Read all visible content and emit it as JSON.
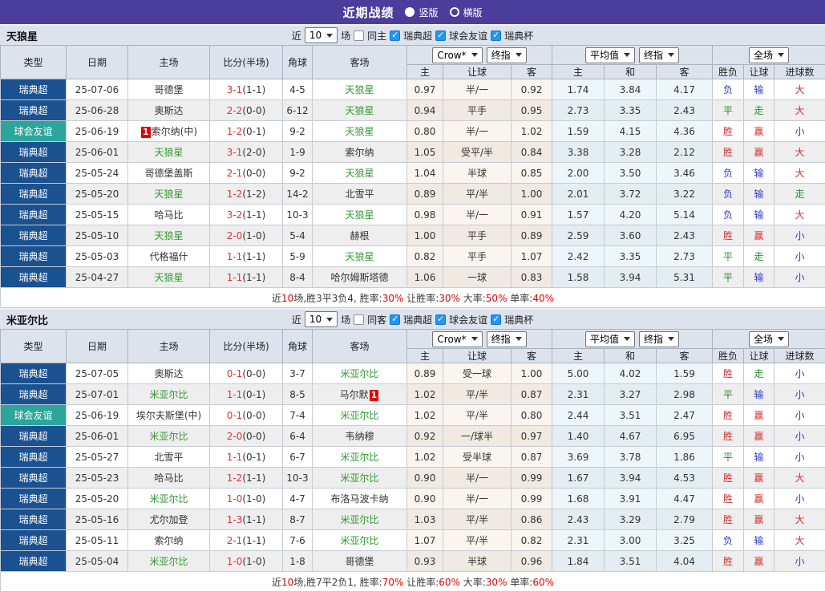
{
  "colors": {
    "titlebar_purple": "#4a3d9c",
    "league_type_navy": "#1a5190",
    "friendly_type_teal": "#2aa69a",
    "highlight_team_green": "#339933",
    "score_red": "#e03333",
    "win_red": "#d03030",
    "lose_blue": "#2e3bc0",
    "draw_green": "#2e8b2e",
    "badge_red": "#e60000"
  },
  "header": {
    "title": "近期战绩",
    "radio_vertical": "竖版",
    "radio_horizontal": "横版",
    "selected": "竖版"
  },
  "table": {
    "columns": [
      "类型",
      "日期",
      "主场",
      "比分(半场)",
      "角球",
      "客场",
      "主",
      "让球",
      "客",
      "主",
      "和",
      "客",
      "胜负",
      "让球",
      "进球数"
    ],
    "selects": {
      "bookmaker": "Crow*",
      "index1": "终指",
      "avg": "平均值",
      "index2": "终指",
      "scope": "全场"
    }
  },
  "sections": [
    {
      "team": "天狼星",
      "filter": {
        "near": "近",
        "count": "10",
        "games": "场",
        "same": "同主",
        "same_checked": false,
        "leagues": [
          {
            "label": "瑞典超",
            "checked": true
          },
          {
            "label": "球会友谊",
            "checked": true
          },
          {
            "label": "瑞典杯",
            "checked": true
          }
        ]
      },
      "rows": [
        {
          "type": "瑞典超",
          "type_style": "navy",
          "date": "25-07-06",
          "home": {
            "text": "哥德堡"
          },
          "score": "3-1",
          "half": "(1-1)",
          "corner": "4-5",
          "away": {
            "text": "天狼星",
            "hl": true
          },
          "odds": [
            "0.97",
            "半/一",
            "0.92"
          ],
          "avg": [
            "1.74",
            "3.84",
            "4.17"
          ],
          "res": [
            [
              "负",
              "blue"
            ],
            [
              "输",
              "blue"
            ],
            [
              "大",
              "red"
            ]
          ]
        },
        {
          "type": "瑞典超",
          "type_style": "navy",
          "date": "25-06-28",
          "home": {
            "text": "奥斯达"
          },
          "score": "2-2",
          "half": "(0-0)",
          "corner": "6-12",
          "away": {
            "text": "天狼星",
            "hl": true
          },
          "odds": [
            "0.94",
            "平手",
            "0.95"
          ],
          "avg": [
            "2.73",
            "3.35",
            "2.43"
          ],
          "res": [
            [
              "平",
              "green"
            ],
            [
              "走",
              "green"
            ],
            [
              "大",
              "red"
            ]
          ]
        },
        {
          "type": "球会友谊",
          "type_style": "teal",
          "date": "25-06-19",
          "home": {
            "text": "索尔纳(中)",
            "badge_pre": "1"
          },
          "score": "1-2",
          "half": "(0-1)",
          "corner": "9-2",
          "away": {
            "text": "天狼星",
            "hl": true
          },
          "odds": [
            "0.80",
            "半/一",
            "1.02"
          ],
          "avg": [
            "1.59",
            "4.15",
            "4.36"
          ],
          "res": [
            [
              "胜",
              "red"
            ],
            [
              "赢",
              "red"
            ],
            [
              "小",
              "blue"
            ]
          ]
        },
        {
          "type": "瑞典超",
          "type_style": "navy",
          "date": "25-06-01",
          "home": {
            "text": "天狼星",
            "hl": true
          },
          "score": "3-1",
          "half": "(2-0)",
          "corner": "1-9",
          "away": {
            "text": "索尔纳"
          },
          "odds": [
            "1.05",
            "受平/半",
            "0.84"
          ],
          "avg": [
            "3.38",
            "3.28",
            "2.12"
          ],
          "res": [
            [
              "胜",
              "red"
            ],
            [
              "赢",
              "red"
            ],
            [
              "大",
              "red"
            ]
          ]
        },
        {
          "type": "瑞典超",
          "type_style": "navy",
          "date": "25-05-24",
          "home": {
            "text": "哥德堡盖斯"
          },
          "score": "2-1",
          "half": "(0-0)",
          "corner": "9-2",
          "away": {
            "text": "天狼星",
            "hl": true
          },
          "odds": [
            "1.04",
            "半球",
            "0.85"
          ],
          "avg": [
            "2.00",
            "3.50",
            "3.46"
          ],
          "res": [
            [
              "负",
              "blue"
            ],
            [
              "输",
              "blue"
            ],
            [
              "大",
              "red"
            ]
          ]
        },
        {
          "type": "瑞典超",
          "type_style": "navy",
          "date": "25-05-20",
          "home": {
            "text": "天狼星",
            "hl": true
          },
          "score": "1-2",
          "half": "(1-2)",
          "corner": "14-2",
          "away": {
            "text": "北雪平"
          },
          "odds": [
            "0.89",
            "平/半",
            "1.00"
          ],
          "avg": [
            "2.01",
            "3.72",
            "3.22"
          ],
          "res": [
            [
              "负",
              "blue"
            ],
            [
              "输",
              "blue"
            ],
            [
              "走",
              "green"
            ]
          ]
        },
        {
          "type": "瑞典超",
          "type_style": "navy",
          "date": "25-05-15",
          "home": {
            "text": "哈马比"
          },
          "score": "3-2",
          "half": "(1-1)",
          "corner": "10-3",
          "away": {
            "text": "天狼星",
            "hl": true
          },
          "odds": [
            "0.98",
            "半/一",
            "0.91"
          ],
          "avg": [
            "1.57",
            "4.20",
            "5.14"
          ],
          "res": [
            [
              "负",
              "blue"
            ],
            [
              "输",
              "blue"
            ],
            [
              "大",
              "red"
            ]
          ]
        },
        {
          "type": "瑞典超",
          "type_style": "navy",
          "date": "25-05-10",
          "home": {
            "text": "天狼星",
            "hl": true
          },
          "score": "2-0",
          "half": "(1-0)",
          "corner": "5-4",
          "away": {
            "text": "赫根"
          },
          "odds": [
            "1.00",
            "平手",
            "0.89"
          ],
          "avg": [
            "2.59",
            "3.60",
            "2.43"
          ],
          "res": [
            [
              "胜",
              "red"
            ],
            [
              "赢",
              "red"
            ],
            [
              "小",
              "blue"
            ]
          ]
        },
        {
          "type": "瑞典超",
          "type_style": "navy",
          "date": "25-05-03",
          "home": {
            "text": "代格福什"
          },
          "score": "1-1",
          "half": "(1-1)",
          "corner": "5-9",
          "away": {
            "text": "天狼星",
            "hl": true
          },
          "odds": [
            "0.82",
            "平手",
            "1.07"
          ],
          "avg": [
            "2.42",
            "3.35",
            "2.73"
          ],
          "res": [
            [
              "平",
              "green"
            ],
            [
              "走",
              "green"
            ],
            [
              "小",
              "blue"
            ]
          ]
        },
        {
          "type": "瑞典超",
          "type_style": "navy",
          "date": "25-04-27",
          "home": {
            "text": "天狼星",
            "hl": true
          },
          "score": "1-1",
          "half": "(1-1)",
          "corner": "8-4",
          "away": {
            "text": "哈尔姆斯塔德"
          },
          "odds": [
            "1.06",
            "一球",
            "0.83"
          ],
          "avg": [
            "1.58",
            "3.94",
            "5.31"
          ],
          "res": [
            [
              "平",
              "green"
            ],
            [
              "输",
              "blue"
            ],
            [
              "小",
              "blue"
            ]
          ]
        }
      ],
      "summary": [
        [
          "近",
          "dark"
        ],
        [
          "10",
          "red"
        ],
        [
          "场,胜3平3负4, 胜率:",
          "dark"
        ],
        [
          "30%",
          "red"
        ],
        [
          " 让胜率:",
          "dark"
        ],
        [
          "30%",
          "red"
        ],
        [
          " 大率:",
          "dark"
        ],
        [
          "50%",
          "red"
        ],
        [
          " 单率:",
          "dark"
        ],
        [
          "40%",
          "red"
        ]
      ]
    },
    {
      "team": "米亚尔比",
      "filter": {
        "near": "近",
        "count": "10",
        "games": "场",
        "same": "同客",
        "same_checked": false,
        "leagues": [
          {
            "label": "瑞典超",
            "checked": true
          },
          {
            "label": "球会友谊",
            "checked": true
          },
          {
            "label": "瑞典杯",
            "checked": true
          }
        ]
      },
      "rows": [
        {
          "type": "瑞典超",
          "type_style": "navy",
          "date": "25-07-05",
          "home": {
            "text": "奥斯达"
          },
          "score": "0-1",
          "half": "(0-0)",
          "corner": "3-7",
          "away": {
            "text": "米亚尔比",
            "hl": true
          },
          "odds": [
            "0.89",
            "受一球",
            "1.00"
          ],
          "avg": [
            "5.00",
            "4.02",
            "1.59"
          ],
          "res": [
            [
              "胜",
              "red"
            ],
            [
              "走",
              "green"
            ],
            [
              "小",
              "blue"
            ]
          ]
        },
        {
          "type": "瑞典超",
          "type_style": "navy",
          "date": "25-07-01",
          "home": {
            "text": "米亚尔比",
            "hl": true
          },
          "score": "1-1",
          "half": "(0-1)",
          "corner": "8-5",
          "away": {
            "text": "马尔默",
            "badge_post": "1"
          },
          "odds": [
            "1.02",
            "平/半",
            "0.87"
          ],
          "avg": [
            "2.31",
            "3.27",
            "2.98"
          ],
          "res": [
            [
              "平",
              "green"
            ],
            [
              "输",
              "blue"
            ],
            [
              "小",
              "blue"
            ]
          ]
        },
        {
          "type": "球会友谊",
          "type_style": "teal",
          "date": "25-06-19",
          "home": {
            "text": "埃尔夫斯堡(中)"
          },
          "score": "0-1",
          "half": "(0-0)",
          "corner": "7-4",
          "away": {
            "text": "米亚尔比",
            "hl": true
          },
          "odds": [
            "1.02",
            "平/半",
            "0.80"
          ],
          "avg": [
            "2.44",
            "3.51",
            "2.47"
          ],
          "res": [
            [
              "胜",
              "red"
            ],
            [
              "赢",
              "red"
            ],
            [
              "小",
              "blue"
            ]
          ]
        },
        {
          "type": "瑞典超",
          "type_style": "navy",
          "date": "25-06-01",
          "home": {
            "text": "米亚尔比",
            "hl": true
          },
          "score": "2-0",
          "half": "(0-0)",
          "corner": "6-4",
          "away": {
            "text": "韦纳穆"
          },
          "odds": [
            "0.92",
            "一/球半",
            "0.97"
          ],
          "avg": [
            "1.40",
            "4.67",
            "6.95"
          ],
          "res": [
            [
              "胜",
              "red"
            ],
            [
              "赢",
              "red"
            ],
            [
              "小",
              "blue"
            ]
          ]
        },
        {
          "type": "瑞典超",
          "type_style": "navy",
          "date": "25-05-27",
          "home": {
            "text": "北雪平"
          },
          "score": "1-1",
          "half": "(0-1)",
          "corner": "6-7",
          "away": {
            "text": "米亚尔比",
            "hl": true
          },
          "odds": [
            "1.02",
            "受半球",
            "0.87"
          ],
          "avg": [
            "3.69",
            "3.78",
            "1.86"
          ],
          "res": [
            [
              "平",
              "green"
            ],
            [
              "输",
              "blue"
            ],
            [
              "小",
              "blue"
            ]
          ]
        },
        {
          "type": "瑞典超",
          "type_style": "navy",
          "date": "25-05-23",
          "home": {
            "text": "哈马比"
          },
          "score": "1-2",
          "half": "(1-1)",
          "corner": "10-3",
          "away": {
            "text": "米亚尔比",
            "hl": true
          },
          "odds": [
            "0.90",
            "半/一",
            "0.99"
          ],
          "avg": [
            "1.67",
            "3.94",
            "4.53"
          ],
          "res": [
            [
              "胜",
              "red"
            ],
            [
              "赢",
              "red"
            ],
            [
              "大",
              "red"
            ]
          ]
        },
        {
          "type": "瑞典超",
          "type_style": "navy",
          "date": "25-05-20",
          "home": {
            "text": "米亚尔比",
            "hl": true
          },
          "score": "1-0",
          "half": "(1-0)",
          "corner": "4-7",
          "away": {
            "text": "布洛马波卡纳"
          },
          "odds": [
            "0.90",
            "半/一",
            "0.99"
          ],
          "avg": [
            "1.68",
            "3.91",
            "4.47"
          ],
          "res": [
            [
              "胜",
              "red"
            ],
            [
              "赢",
              "red"
            ],
            [
              "小",
              "blue"
            ]
          ]
        },
        {
          "type": "瑞典超",
          "type_style": "navy",
          "date": "25-05-16",
          "home": {
            "text": "尤尔加登"
          },
          "score": "1-3",
          "half": "(1-1)",
          "corner": "8-7",
          "away": {
            "text": "米亚尔比",
            "hl": true
          },
          "odds": [
            "1.03",
            "平/半",
            "0.86"
          ],
          "avg": [
            "2.43",
            "3.29",
            "2.79"
          ],
          "res": [
            [
              "胜",
              "red"
            ],
            [
              "赢",
              "red"
            ],
            [
              "大",
              "red"
            ]
          ]
        },
        {
          "type": "瑞典超",
          "type_style": "navy",
          "date": "25-05-11",
          "home": {
            "text": "索尔纳"
          },
          "score": "2-1",
          "half": "(1-1)",
          "corner": "7-6",
          "away": {
            "text": "米亚尔比",
            "hl": true
          },
          "odds": [
            "1.07",
            "平/半",
            "0.82"
          ],
          "avg": [
            "2.31",
            "3.00",
            "3.25"
          ],
          "res": [
            [
              "负",
              "blue"
            ],
            [
              "输",
              "blue"
            ],
            [
              "大",
              "red"
            ]
          ]
        },
        {
          "type": "瑞典超",
          "type_style": "navy",
          "date": "25-05-04",
          "home": {
            "text": "米亚尔比",
            "hl": true
          },
          "score": "1-0",
          "half": "(1-0)",
          "corner": "1-8",
          "away": {
            "text": "哥德堡"
          },
          "odds": [
            "0.93",
            "半球",
            "0.96"
          ],
          "avg": [
            "1.84",
            "3.51",
            "4.04"
          ],
          "res": [
            [
              "胜",
              "red"
            ],
            [
              "赢",
              "red"
            ],
            [
              "小",
              "blue"
            ]
          ]
        }
      ],
      "summary": [
        [
          "近",
          "dark"
        ],
        [
          "10",
          "red"
        ],
        [
          "场,胜7平2负1, 胜率:",
          "dark"
        ],
        [
          "70%",
          "red"
        ],
        [
          " 让胜率:",
          "dark"
        ],
        [
          "60%",
          "red"
        ],
        [
          " 大率:",
          "dark"
        ],
        [
          "30%",
          "red"
        ],
        [
          " 单率:",
          "dark"
        ],
        [
          "60%",
          "red"
        ]
      ]
    }
  ]
}
